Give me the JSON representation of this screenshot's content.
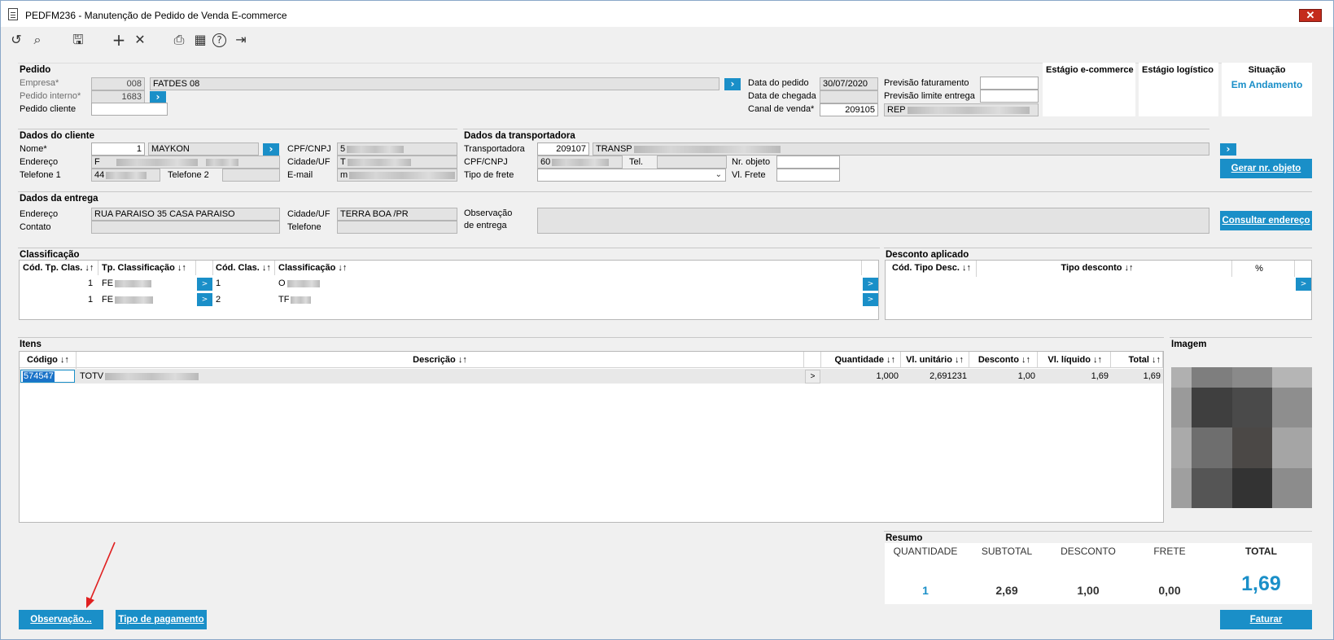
{
  "window": {
    "title": "PEDFM236 - Manutenção de Pedido de Venda E-commerce",
    "close_label": "✕"
  },
  "toolbar": {
    "undo": "↺",
    "search": "⌕",
    "save": "🖫",
    "add": "+",
    "cancel": "✕",
    "print": "⎙",
    "calendar": "▦",
    "help": "?",
    "exit": "⇥"
  },
  "pedido": {
    "section": "Pedido",
    "empresa_label": "Empresa*",
    "empresa_code": "008",
    "empresa_name": "FATDES 08",
    "pedido_interno_label": "Pedido interno*",
    "pedido_interno": "1683",
    "pedido_cliente_label": "Pedido cliente",
    "pedido_cliente": "",
    "data_pedido_label": "Data do pedido",
    "data_pedido": "30/07/2020",
    "data_chegada_label": "Data de chegada",
    "data_chegada": "",
    "canal_label": "Canal de venda*",
    "canal_code": "209105",
    "canal_name": "REP",
    "prev_fat_label": "Previsão faturamento",
    "prev_fat": "",
    "prev_lim_label": "Previsão limite entrega",
    "prev_lim": ""
  },
  "status": {
    "estagio_ecommerce_label": "Estágio e-commerce",
    "estagio_logistico_label": "Estágio logístico",
    "situacao_label": "Situação",
    "situacao_value": "Em Andamento"
  },
  "cliente": {
    "section": "Dados do cliente",
    "nome_label": "Nome*",
    "nome_code": "1",
    "nome": "MAYKON",
    "endereco_label": "Endereço",
    "endereco": "F",
    "telefone1_label": "Telefone 1",
    "telefone1": "44",
    "telefone2_label": "Telefone 2",
    "telefone2": "",
    "cpf_label": "CPF/CNPJ",
    "cpf": "5",
    "cidade_label": "Cidade/UF",
    "cidade": "T",
    "email_label": "E-mail",
    "email": "m"
  },
  "transportadora": {
    "section": "Dados da transportadora",
    "transp_label": "Transportadora",
    "transp_code": "209107",
    "transp_name": "TRANSP",
    "cpf_label": "CPF/CNPJ",
    "cpf": "60",
    "tel_label": "Tel.",
    "tel": "",
    "frete_label": "Tipo de frete",
    "frete": "",
    "nr_objeto_label": "Nr. objeto",
    "nr_objeto": "",
    "vl_frete_label": "Vl. Frete",
    "vl_frete": "",
    "gerar_btn": "Gerar nr. objeto"
  },
  "entrega": {
    "section": "Dados da entrega",
    "endereco_label": "Endereço",
    "endereco": "RUA  PARAISO 35   CASA   PARAISO",
    "contato_label": "Contato",
    "contato": "",
    "cidade_label": "Cidade/UF",
    "cidade": "TERRA BOA /PR",
    "telefone_label": "Telefone",
    "telefone": "",
    "obs_label1": "Observação",
    "obs_label2": "de entrega",
    "obs": "",
    "consultar_btn": "Consultar endereço"
  },
  "classificacao": {
    "section": "Classificação",
    "headers": [
      "Cód. Tp. Clas. ↓↑",
      "Tp. Classificação ↓↑",
      "Cód. Clas. ↓↑",
      "Classificação ↓↑"
    ],
    "rows": [
      {
        "cod_tp": "1",
        "tp": "FE",
        "cod": "1",
        "clas": "O"
      },
      {
        "cod_tp": "1",
        "tp": "FE",
        "cod": "2",
        "clas": "TF"
      }
    ]
  },
  "desconto": {
    "section": "Desconto aplicado",
    "headers": [
      "Cód. Tipo Desc. ↓↑",
      "Tipo desconto ↓↑",
      "%"
    ]
  },
  "itens": {
    "section": "Itens",
    "headers": [
      "Código ↓↑",
      "Descrição ↓↑",
      "Quantidade ↓↑",
      "Vl. unitário ↓↑",
      "Desconto ↓↑",
      "Vl. líquido ↓↑",
      "Total ↓↑"
    ],
    "rows": [
      {
        "codigo": "574547",
        "descricao": "TOTV",
        "quantidade": "1,000",
        "vl_unitario": "2,691231",
        "desconto": "1,00",
        "vl_liquido": "1,69",
        "total": "1,69"
      }
    ],
    "expand_label": ">"
  },
  "imagem": {
    "section": "Imagem"
  },
  "resumo": {
    "section": "Resumo",
    "quantidade_label": "QUANTIDADE",
    "quantidade": "1",
    "subtotal_label": "SUBTOTAL",
    "subtotal": "2,69",
    "desconto_label": "DESCONTO",
    "desconto": "1,00",
    "frete_label": "FRETE",
    "frete": "0,00",
    "total_label": "TOTAL",
    "total": "1,69"
  },
  "footer": {
    "observacao_btn": "Observação...",
    "pagamento_btn": "Tipo de pagamento",
    "faturar_btn": "Faturar"
  },
  "colors": {
    "accent": "#1a8fc8",
    "annotation": "#e02020"
  }
}
